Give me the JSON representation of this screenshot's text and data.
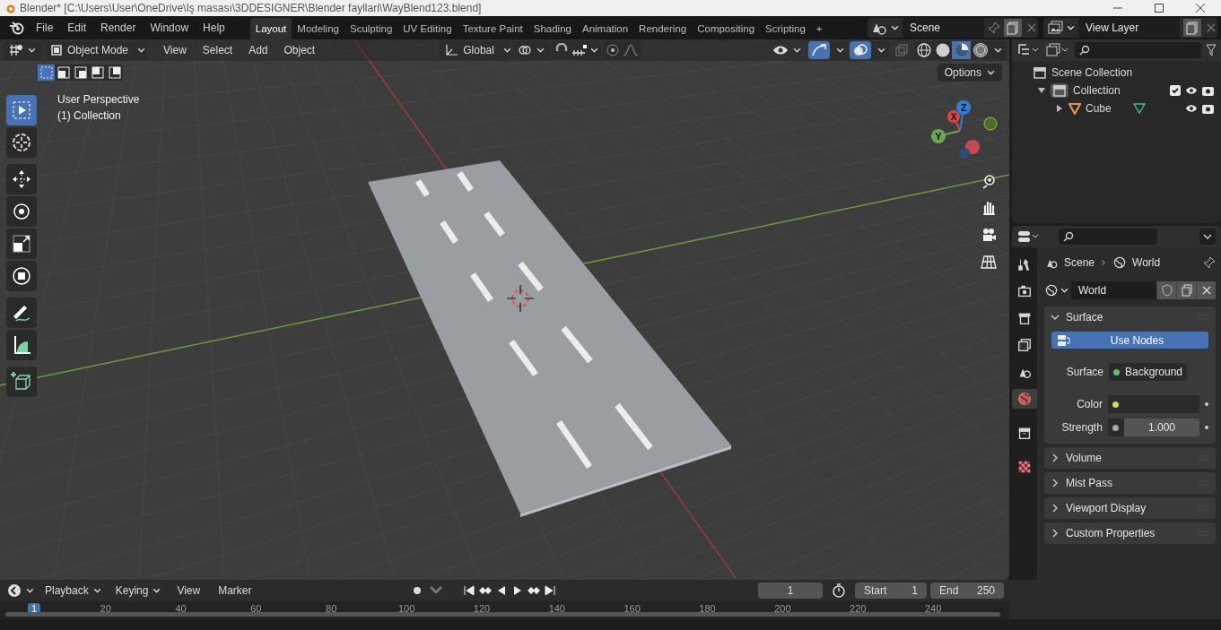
{
  "window": {
    "title": "Blender* [C:\\Users\\User\\OneDrive\\Iş masası\\3DDESIGNER\\Blender fayllari\\WayBlend123.blend]"
  },
  "menu": [
    "File",
    "Edit",
    "Render",
    "Window",
    "Help"
  ],
  "workspaces": [
    {
      "label": "Layout",
      "selected": true
    },
    {
      "label": "Modeling",
      "selected": false
    },
    {
      "label": "Sculpting",
      "selected": false
    },
    {
      "label": "UV Editing",
      "selected": false
    },
    {
      "label": "Texture Paint",
      "selected": false
    },
    {
      "label": "Shading",
      "selected": false
    },
    {
      "label": "Animation",
      "selected": false
    },
    {
      "label": "Rendering",
      "selected": false
    },
    {
      "label": "Compositing",
      "selected": false
    },
    {
      "label": "Scripting",
      "selected": false
    },
    {
      "label": "+",
      "selected": false
    }
  ],
  "scene": {
    "name": "Scene"
  },
  "view_layer": {
    "name": "View Layer"
  },
  "viewport": {
    "mode": "Object Mode",
    "menus": [
      "View",
      "Select",
      "Add",
      "Object"
    ],
    "orientation": "Global",
    "options": "Options",
    "select_modes": [
      {
        "selected": true
      },
      {
        "selected": false
      },
      {
        "selected": false
      },
      {
        "selected": false
      },
      {
        "selected": false
      }
    ],
    "shading": [
      {
        "kind": "wireframe",
        "selected": false
      },
      {
        "kind": "solid",
        "selected": false
      },
      {
        "kind": "material",
        "selected": true
      },
      {
        "kind": "rendered",
        "selected": false
      }
    ],
    "overlay_lines": [
      "User Perspective",
      "(1) Collection"
    ],
    "tools": [
      {
        "kind": "select",
        "selected": true
      },
      {
        "kind": "cursor",
        "selected": false
      },
      {
        "kind": "move",
        "selected": false
      },
      {
        "kind": "rotate",
        "selected": false
      },
      {
        "kind": "scale",
        "selected": false
      },
      {
        "kind": "transform",
        "selected": false
      },
      {
        "kind": "annotate",
        "selected": false
      },
      {
        "kind": "measure",
        "selected": false
      },
      {
        "kind": "add-cube",
        "selected": false
      }
    ],
    "gizmo": {
      "x": "X",
      "y": "Y",
      "z": "Z"
    }
  },
  "outliner": {
    "items": [
      {
        "label": "Scene Collection",
        "kind": "scene",
        "children": [
          {
            "label": "Collection",
            "kind": "collection",
            "expanded": true,
            "checked": true,
            "children": [
              {
                "label": "Cube",
                "kind": "mesh",
                "expanded": false
              }
            ]
          }
        ]
      }
    ]
  },
  "properties": {
    "tabs": [
      {
        "kind": "tool",
        "selected": false
      },
      {
        "kind": "render",
        "selected": false
      },
      {
        "kind": "output",
        "selected": false
      },
      {
        "kind": "view-layer",
        "selected": false
      },
      {
        "kind": "scene",
        "selected": false
      },
      {
        "kind": "world",
        "selected": true
      },
      {
        "kind": "collection",
        "selected": false
      },
      {
        "kind": "texture",
        "selected": false
      }
    ],
    "breadcrumb": [
      "Scene",
      "World"
    ],
    "world_name": "World",
    "panels": [
      {
        "title": "Surface",
        "expanded": true,
        "button": "Use Nodes",
        "fields": [
          {
            "kind": "shader",
            "label": "Surface",
            "value": "Background"
          },
          {
            "kind": "color",
            "label": "Color"
          },
          {
            "kind": "number",
            "label": "Strength",
            "value": "1.000"
          }
        ]
      },
      {
        "title": "Volume",
        "expanded": false
      },
      {
        "title": "Mist Pass",
        "expanded": false
      },
      {
        "title": "Viewport Display",
        "expanded": false
      },
      {
        "title": "Custom Properties",
        "expanded": false
      }
    ]
  },
  "timeline": {
    "menus": [
      "Playback",
      "Keying",
      "View",
      "Marker"
    ],
    "current_frame": "1",
    "start_label": "Start",
    "start": "1",
    "end_label": "End",
    "end": "250",
    "ruler": [
      "1",
      "20",
      "40",
      "60",
      "80",
      "100",
      "120",
      "140",
      "160",
      "180",
      "200",
      "220",
      "240"
    ]
  }
}
